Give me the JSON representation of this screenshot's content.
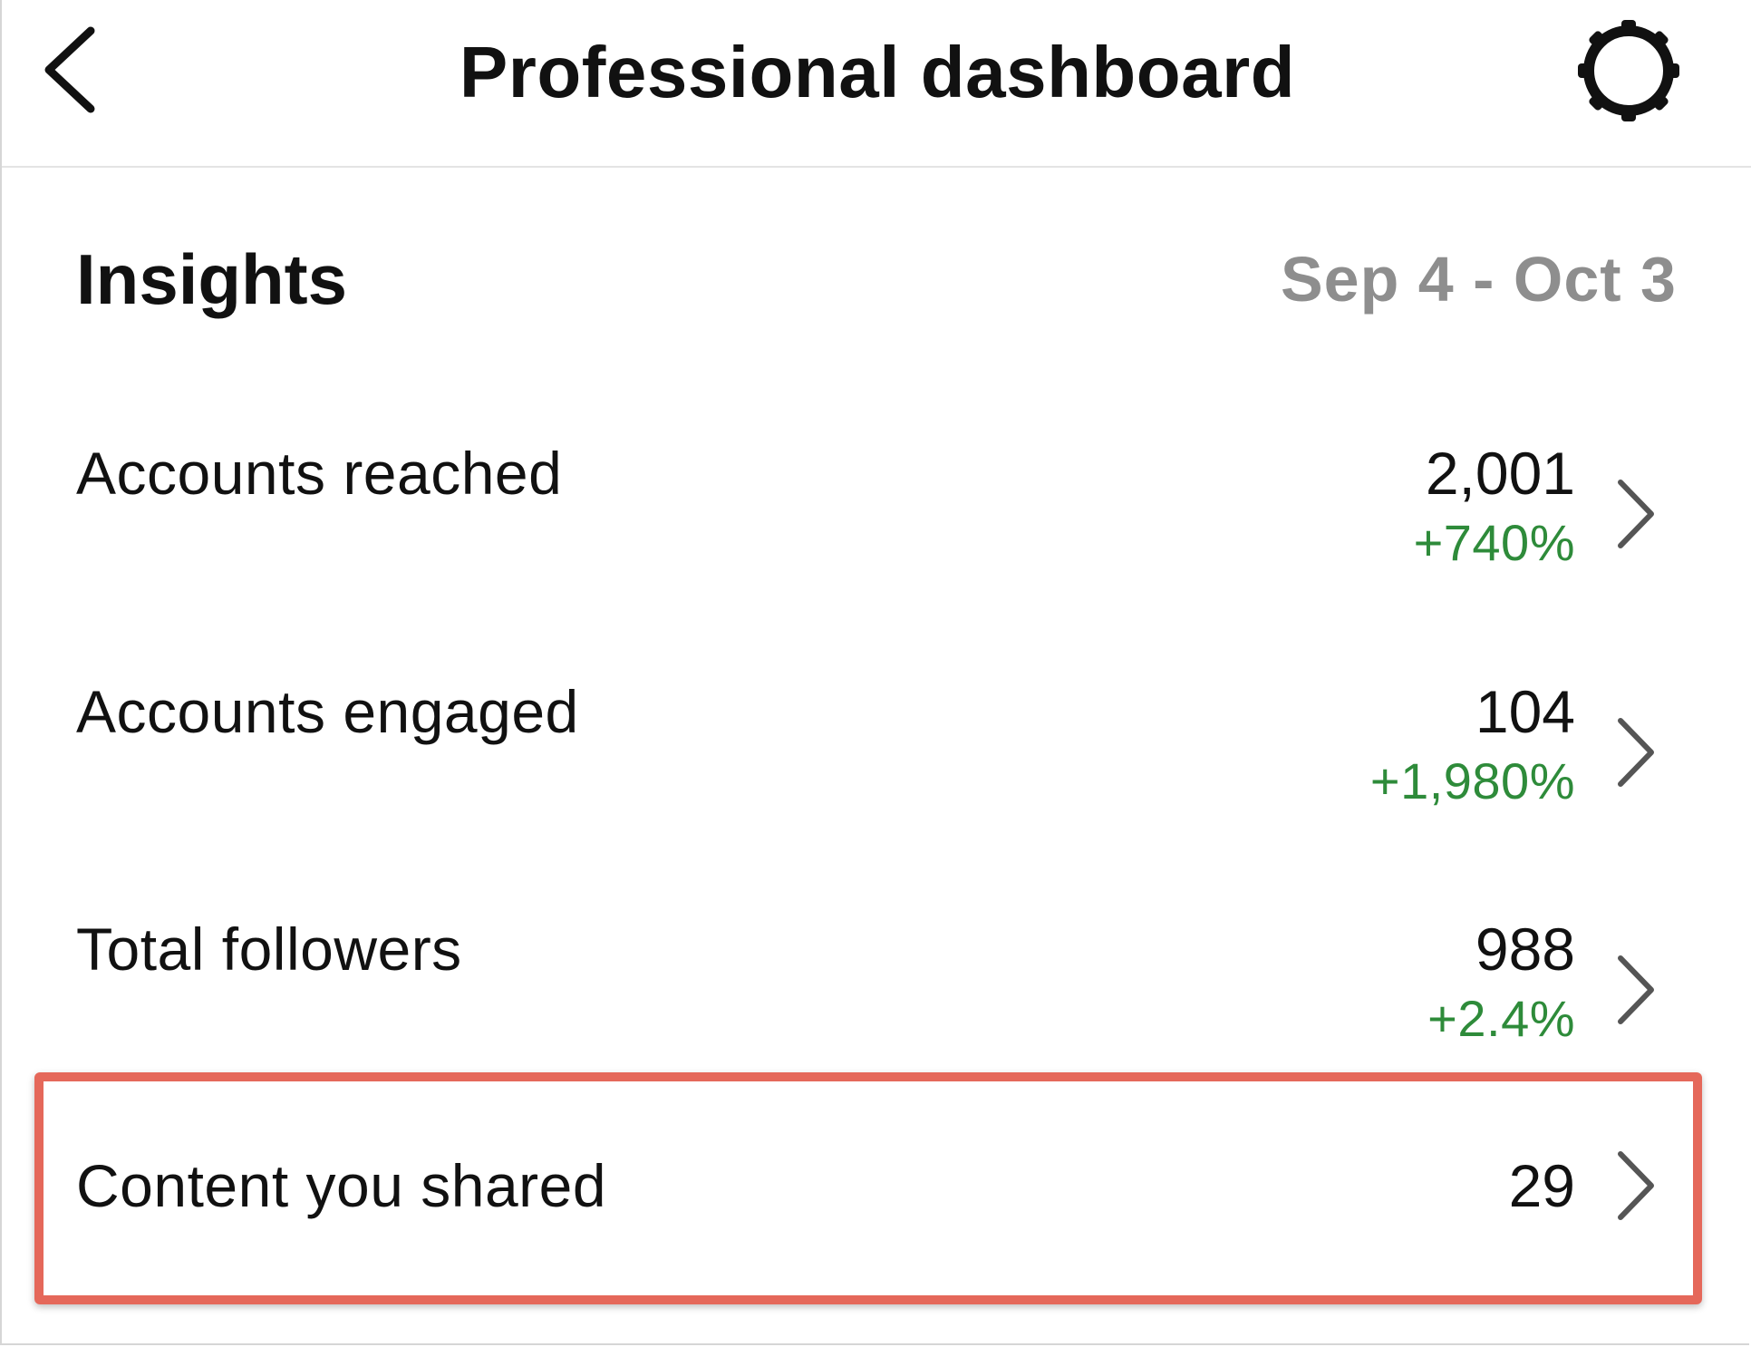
{
  "header": {
    "title": "Professional dashboard",
    "back_icon": "chevron-left-icon",
    "settings_icon": "gear-icon"
  },
  "insights": {
    "title": "Insights",
    "date_range": "Sep 4 - Oct 3"
  },
  "metrics": [
    {
      "label": "Accounts reached",
      "value": "2,001",
      "change": "+740%"
    },
    {
      "label": "Accounts engaged",
      "value": "104",
      "change": "+1,980%"
    },
    {
      "label": "Total followers",
      "value": "988",
      "change": "+2.4%"
    },
    {
      "label": "Content you shared",
      "value": "29",
      "change": ""
    }
  ],
  "colors": {
    "positive_change": "#2e8b3a",
    "date_range": "#8e8e8e",
    "highlight": "#e5685a"
  }
}
